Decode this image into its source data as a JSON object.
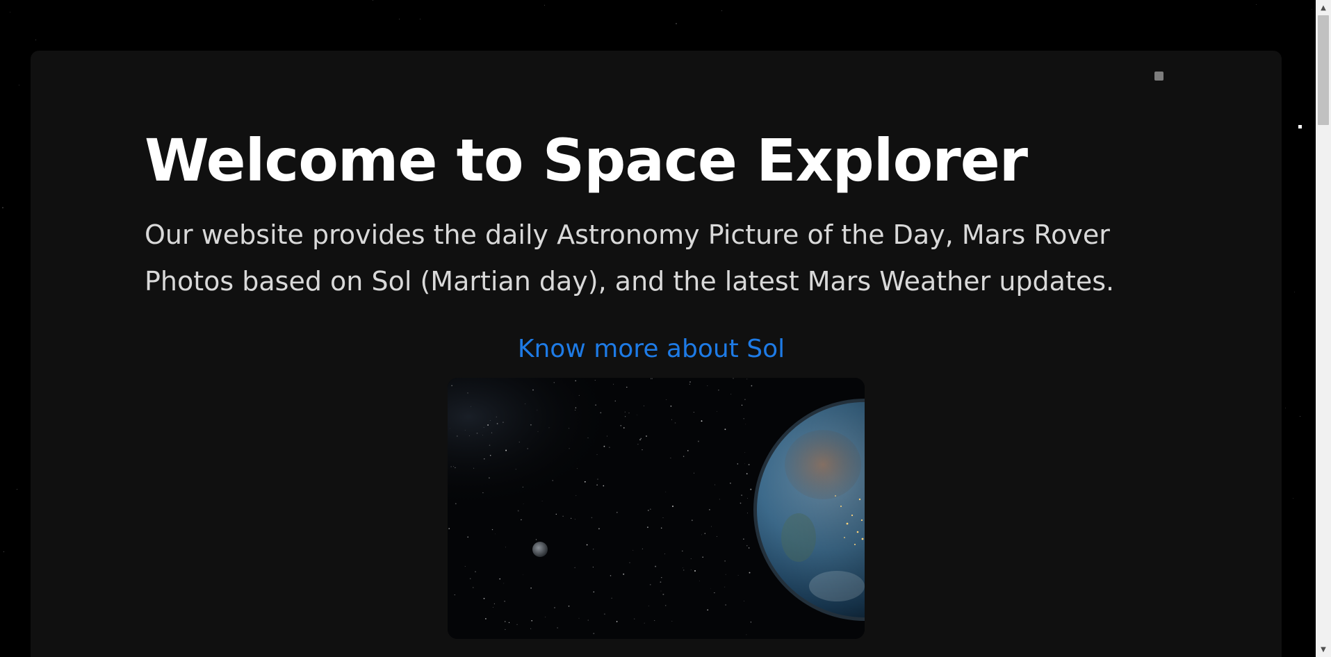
{
  "hero": {
    "title": "Welcome to Space Explorer",
    "description": "Our website provides the daily Astronomy Picture of the Day, Mars Rover Photos based on Sol (Martian day), and the latest Mars Weather updates.",
    "link_label": "Know more about Sol"
  },
  "colors": {
    "page_background": "#000000",
    "card_background": "#101010",
    "title": "#ffffff",
    "description": "#d9d9d9",
    "link": "#1e7be6"
  },
  "icons": {
    "corner": "square-icon",
    "scroll_up": "triangle-up-icon",
    "scroll_down": "triangle-down-icon"
  }
}
